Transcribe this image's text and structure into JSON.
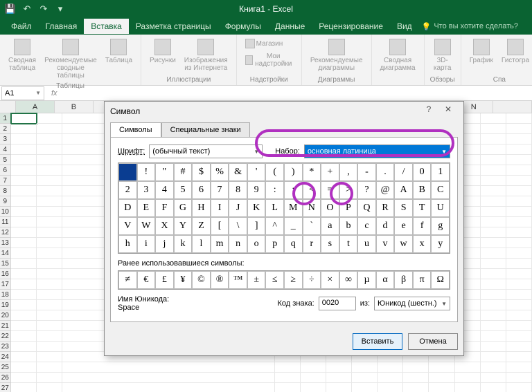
{
  "titlebar": {
    "title": "Книга1 - Excel"
  },
  "tabs": [
    "Файл",
    "Главная",
    "Вставка",
    "Разметка страницы",
    "Формулы",
    "Данные",
    "Рецензирование",
    "Вид"
  ],
  "active_tab": 2,
  "tell_me": "Что вы хотите сделать?",
  "ribbon": {
    "groups": [
      {
        "label": "Таблицы",
        "items": [
          "Сводная таблица",
          "Рекомендуемые сводные таблицы",
          "Таблица"
        ]
      },
      {
        "label": "Иллюстрации",
        "items": [
          "Рисунки",
          "Изображения из Интернета"
        ]
      },
      {
        "label": "Надстройки",
        "items": [
          "Магазин",
          "Мои надстройки"
        ]
      },
      {
        "label": "Диаграммы",
        "items": [
          "Рекомендуемые диаграммы"
        ]
      },
      {
        "label": "",
        "items": [
          "Сводная диаграмма"
        ]
      },
      {
        "label": "Обзоры",
        "items": [
          "3D-карта"
        ]
      },
      {
        "label": "Спа",
        "items": [
          "График",
          "Гистогра"
        ]
      }
    ]
  },
  "namebox": "A1",
  "columns": [
    "A",
    "B",
    "",
    "",
    "",
    "",
    "",
    "",
    "",
    "",
    "",
    "M",
    "N",
    ""
  ],
  "dialog": {
    "title": "Символ",
    "tabs": [
      "Символы",
      "Специальные знаки"
    ],
    "font_label": "Шрифт:",
    "font_value": "(обычный текст)",
    "set_label": "Набор:",
    "set_value": "основная латиница",
    "chars": [
      [
        " ",
        "!",
        "\"",
        "#",
        "$",
        "%",
        "&",
        "'",
        "(",
        ")",
        "*",
        "+",
        ",",
        "-",
        ".",
        "/",
        "0",
        "1"
      ],
      [
        "2",
        "3",
        "4",
        "5",
        "6",
        "7",
        "8",
        "9",
        ":",
        ";",
        "<",
        "=",
        ">",
        "?",
        "@",
        "A",
        "B",
        "C"
      ],
      [
        "D",
        "E",
        "F",
        "G",
        "H",
        "I",
        "J",
        "K",
        "L",
        "M",
        "N",
        "O",
        "P",
        "Q",
        "R",
        "S",
        "T",
        "U"
      ],
      [
        "V",
        "W",
        "X",
        "Y",
        "Z",
        "[",
        "\\",
        "]",
        "^",
        "_",
        "`",
        "a",
        "b",
        "c",
        "d",
        "e",
        "f",
        "g"
      ],
      [
        "h",
        "i",
        "j",
        "k",
        "l",
        "m",
        "n",
        "o",
        "p",
        "q",
        "r",
        "s",
        "t",
        "u",
        "v",
        "w",
        "x",
        "y"
      ]
    ],
    "recent_label": "Ранее использовавшиеся символы:",
    "recent": [
      "≠",
      "€",
      "£",
      "¥",
      "©",
      "®",
      "™",
      "±",
      "≤",
      "≥",
      "÷",
      "×",
      "∞",
      "µ",
      "α",
      "β",
      "π",
      "Ω"
    ],
    "uni_name_label": "Имя Юникода:",
    "uni_name_value": "Space",
    "code_label": "Код знака:",
    "code_value": "0020",
    "from_label": "из:",
    "from_value": "Юникод (шестн.)",
    "insert": "Вставить",
    "cancel": "Отмена"
  }
}
